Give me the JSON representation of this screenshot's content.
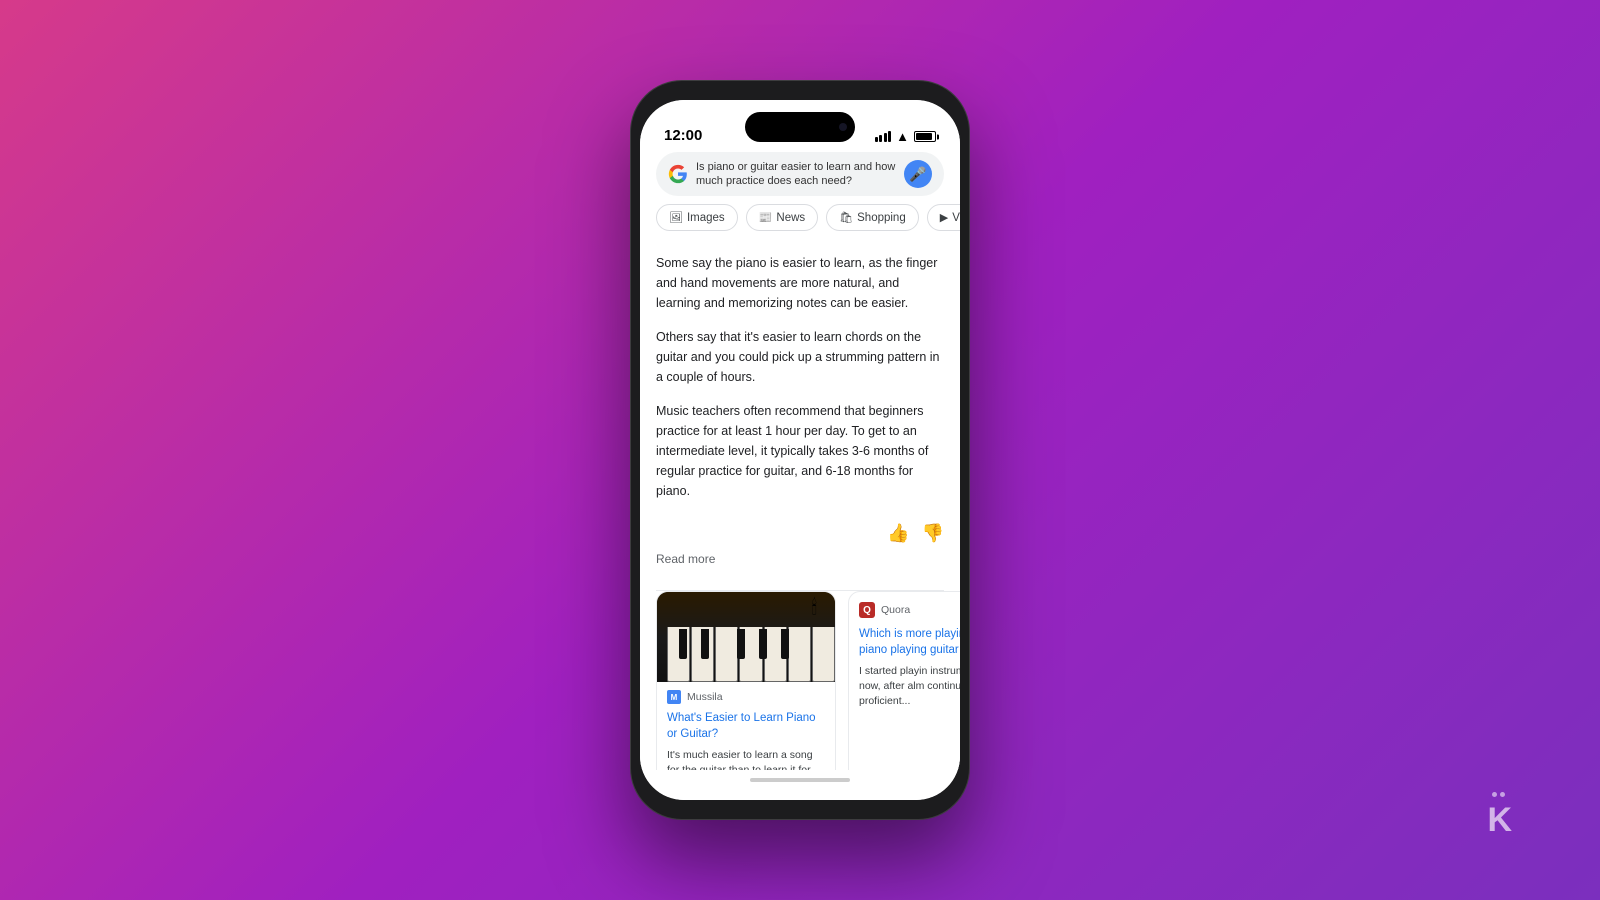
{
  "background": {
    "gradient": "linear-gradient(135deg, #d63a8a 0%, #a020c0 50%, #7b2fbe 100%)"
  },
  "phone": {
    "status_bar": {
      "time": "12:00"
    },
    "search_bar": {
      "query": "Is piano or guitar easier to learn and how much practice does each need?",
      "google_label": "G"
    },
    "filter_tabs": [
      {
        "icon": "🖼",
        "label": "Images"
      },
      {
        "icon": "📰",
        "label": "News"
      },
      {
        "icon": "🛍",
        "label": "Shopping"
      },
      {
        "icon": "▶",
        "label": "Vide..."
      }
    ],
    "answer": {
      "paragraphs": [
        "Some say the piano is easier to learn, as the finger and hand movements are more natural, and learning and memorizing notes can be easier.",
        "Others say that it's easier to learn chords on the guitar and you could pick up a strumming pattern in a couple of hours.",
        "Music teachers often recommend that beginners practice for at least 1 hour per day. To get to an intermediate level, it typically takes 3-6 months of regular practice for guitar, and 6-18 months for piano."
      ],
      "read_more": "Read more"
    },
    "cards": [
      {
        "source_name": "Mussila",
        "title": "What's Easier to Learn Piano or Guitar?",
        "snippet": "It's much easier to learn a song for the guitar than to learn it for"
      },
      {
        "source_name": "Quora",
        "title": "Which is more playing piano playing guitar",
        "snippet": "I started playin instruments th now, after alm continue to d proficient..."
      }
    ]
  },
  "watermark": {
    "dots": [
      "·",
      "·"
    ],
    "text": "K"
  }
}
